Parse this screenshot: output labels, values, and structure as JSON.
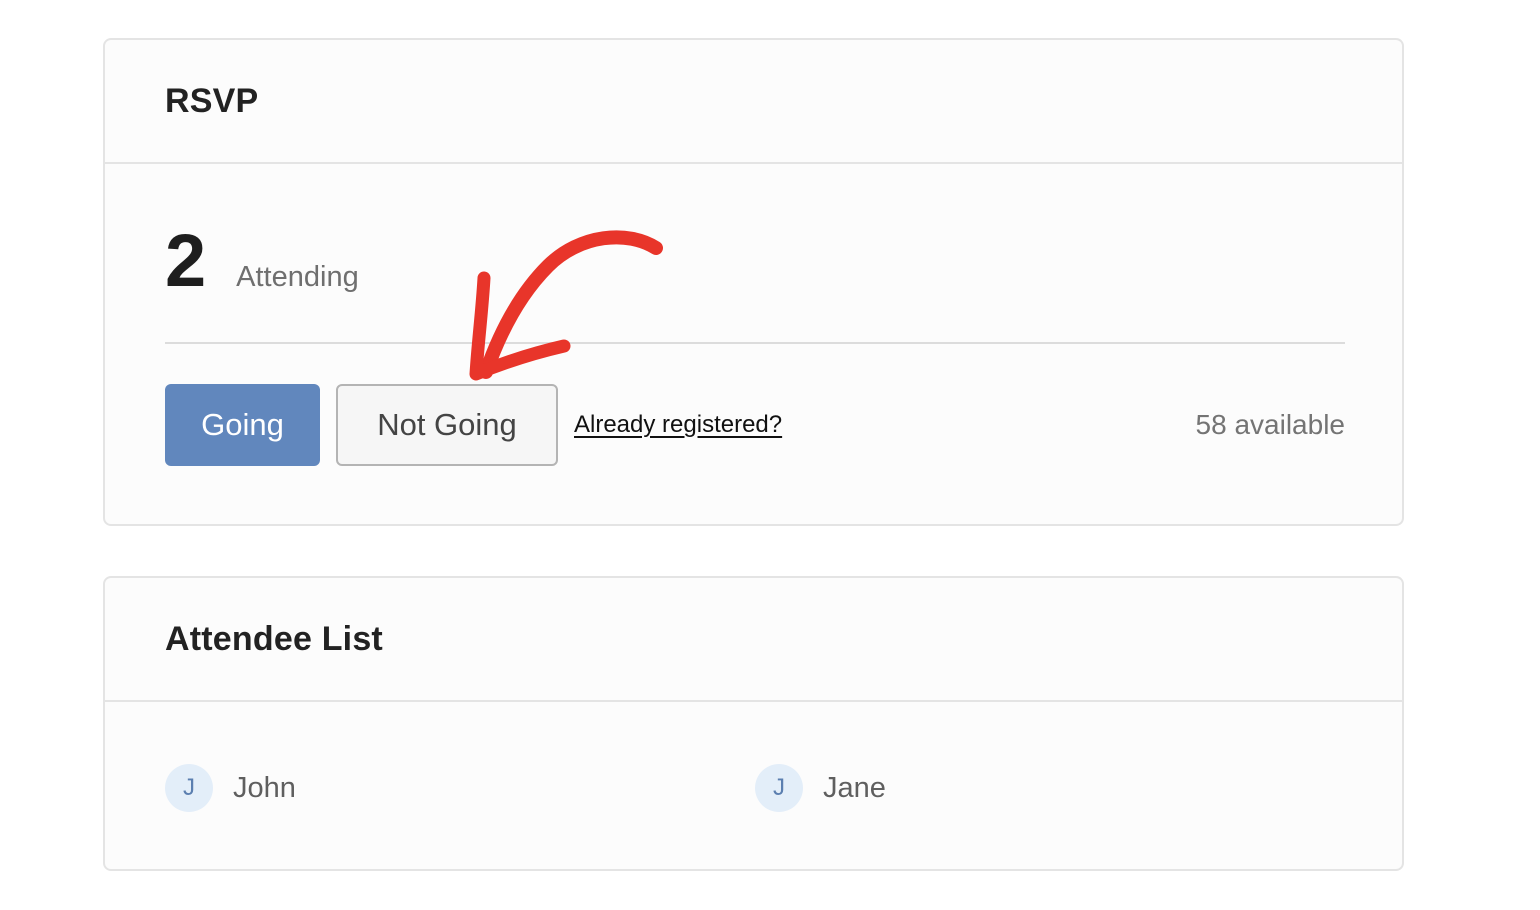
{
  "rsvp": {
    "title": "RSVP",
    "count": "2",
    "count_label": "Attending",
    "going_label": "Going",
    "not_going_label": "Not Going",
    "registered_link": "Already registered?",
    "available_text": "58 available"
  },
  "attendees": {
    "title": "Attendee List",
    "items": [
      {
        "initial": "J",
        "name": "John"
      },
      {
        "initial": "J",
        "name": "Jane"
      }
    ]
  },
  "colors": {
    "going_button": "#6187bd",
    "annotation_arrow": "#e8352a",
    "avatar_bg": "#e3eef9"
  },
  "icons": {
    "annotation": "curved-arrow-icon"
  }
}
